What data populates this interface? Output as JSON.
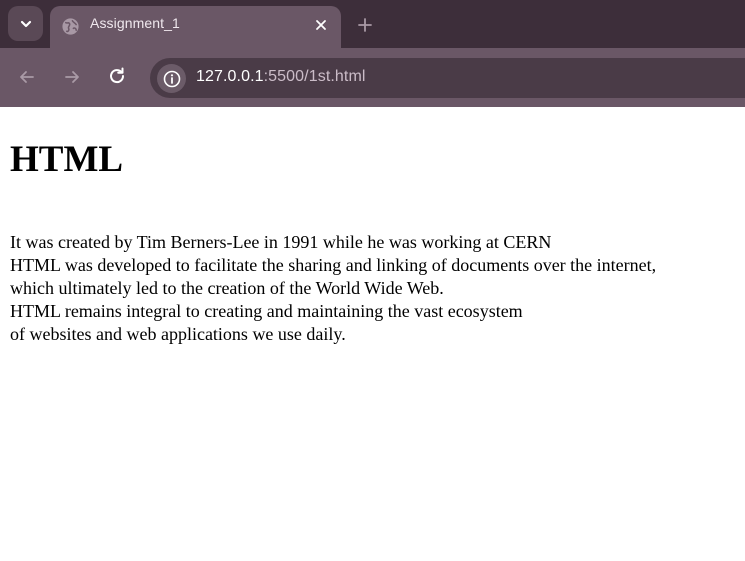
{
  "browser": {
    "tab": {
      "title": "Assignment_1"
    },
    "address_bar": {
      "host": "127.0.0.1",
      "path": ":5500/1st.html"
    },
    "icons": [
      "chevron-down-icon",
      "globe-icon",
      "close-icon",
      "plus-icon",
      "back-arrow-icon",
      "forward-arrow-icon",
      "reload-icon",
      "info-icon"
    ],
    "colors": {
      "tabstrip": "#3d2e3a",
      "active_tab": "#6a5766",
      "omnibox": "#4a3b47"
    }
  },
  "page": {
    "heading": "HTML",
    "lines": [
      "It was created by Tim Berners-Lee in 1991 while he was working at CERN",
      "HTML was developed to facilitate the sharing and linking of documents over the internet,",
      "which ultimately led to the creation of the World Wide Web.",
      "HTML remains integral to creating and maintaining the vast ecosystem",
      "of websites and web applications we use daily."
    ]
  }
}
